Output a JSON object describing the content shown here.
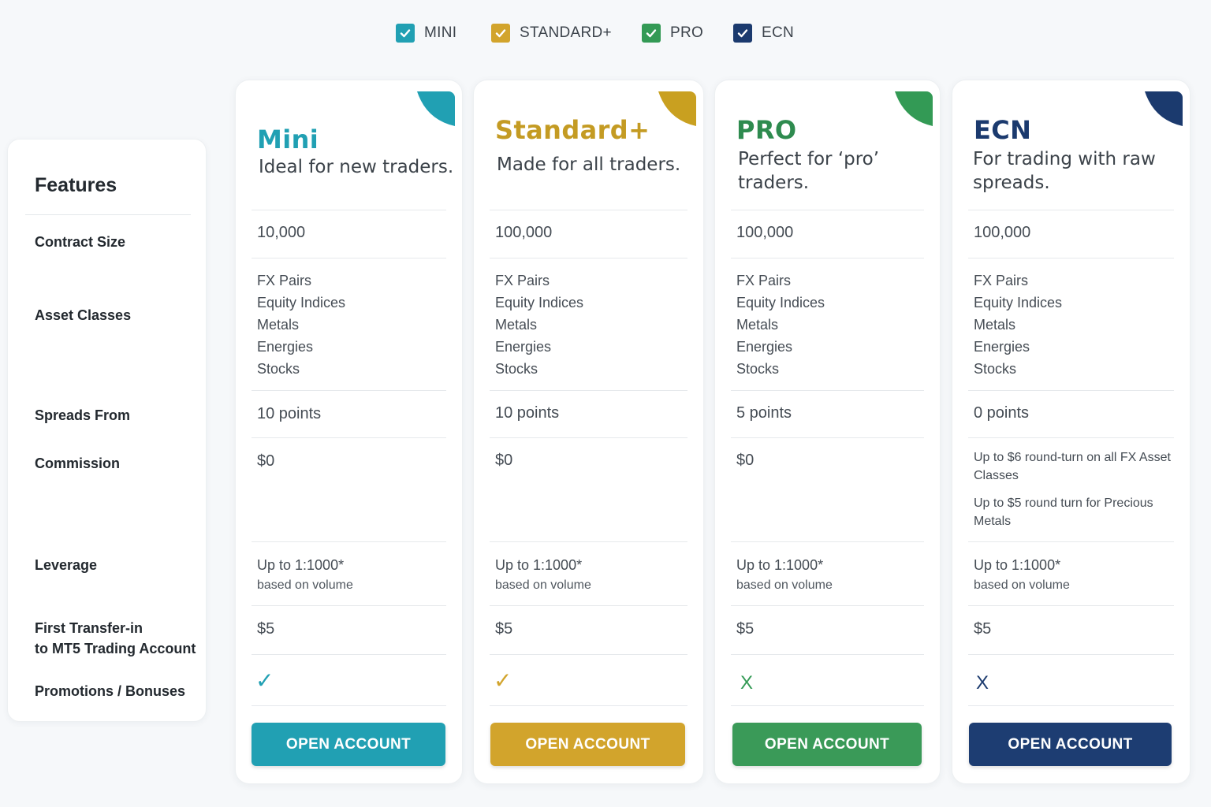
{
  "filters": [
    {
      "label": "MINI",
      "color": "#21a0b3",
      "checked": true,
      "icon": "check-icon"
    },
    {
      "label": "STANDARD+",
      "color": "#d2a42c",
      "checked": true,
      "icon": "check-icon"
    },
    {
      "label": "PRO",
      "color": "#339a55",
      "checked": true,
      "icon": "check-icon"
    },
    {
      "label": "ECN",
      "color": "#1b3a6e",
      "checked": true,
      "icon": "check-icon"
    }
  ],
  "features": {
    "title": "Features",
    "rows": {
      "contract_size": "Contract Size",
      "asset_classes": "Asset Classes",
      "spreads_from": "Spreads From",
      "commission": "Commission",
      "leverage": "Leverage",
      "first_transfer_line1": "First Transfer-in",
      "first_transfer_line2": "to MT5 Trading Account",
      "promotions": "Promotions / Bonuses"
    }
  },
  "plans": [
    {
      "name": "Mini",
      "color": "#21a0b3",
      "tagline": "Ideal for new traders.",
      "contract_size": "10,000",
      "assets": [
        "FX Pairs",
        "Equity Indices",
        "Metals",
        "Energies",
        "Stocks"
      ],
      "spreads": "10 points",
      "commission": [
        "$0"
      ],
      "leverage": "Up to 1:1000*",
      "leverage_note": "based on volume",
      "first_transfer": "$5",
      "promotions": "✓",
      "promotions_icon": "check-icon",
      "button": "OPEN ACCOUNT"
    },
    {
      "name": "Standard+",
      "color": "#c49b23",
      "button_color": "#d2a42c",
      "tagline": "Made for all traders.",
      "contract_size": "100,000",
      "assets": [
        "FX Pairs",
        "Equity Indices",
        "Metals",
        "Energies",
        "Stocks"
      ],
      "spreads": "10 points",
      "commission": [
        "$0"
      ],
      "leverage": "Up to 1:1000*",
      "leverage_note": "based on volume",
      "first_transfer": "$5",
      "promotions": "✓",
      "promotions_icon": "check-icon",
      "button": "OPEN ACCOUNT"
    },
    {
      "name": "PRO",
      "color": "#2e8b4f",
      "button_color": "#3a9a58",
      "tagline_lines": [
        "Perfect for ‘pro’",
        "traders."
      ],
      "contract_size": "100,000",
      "assets": [
        "FX Pairs",
        "Equity Indices",
        "Metals",
        "Energies",
        "Stocks"
      ],
      "spreads": "5 points",
      "commission": [
        "$0"
      ],
      "leverage": "Up to 1:1000*",
      "leverage_note": "based on volume",
      "first_transfer": "$5",
      "promotions": "X",
      "promotions_icon": "cross-icon",
      "button": "OPEN ACCOUNT"
    },
    {
      "name": "ECN",
      "color": "#1b3a6e",
      "button_color": "#1d3d72",
      "tagline_lines": [
        "For trading with raw",
        "spreads."
      ],
      "contract_size": "100,000",
      "assets": [
        "FX Pairs",
        "Equity Indices",
        "Metals",
        "Energies",
        "Stocks"
      ],
      "spreads": "0 points",
      "commission": [
        "Up to $6 round-turn on all  FX Asset Classes",
        "Up to $5 round turn for Precious Metals"
      ],
      "leverage": "Up to 1:1000*",
      "leverage_note": "based on volume",
      "first_transfer": "$5",
      "promotions": "X",
      "promotions_icon": "cross-icon",
      "button": "OPEN ACCOUNT"
    }
  ]
}
